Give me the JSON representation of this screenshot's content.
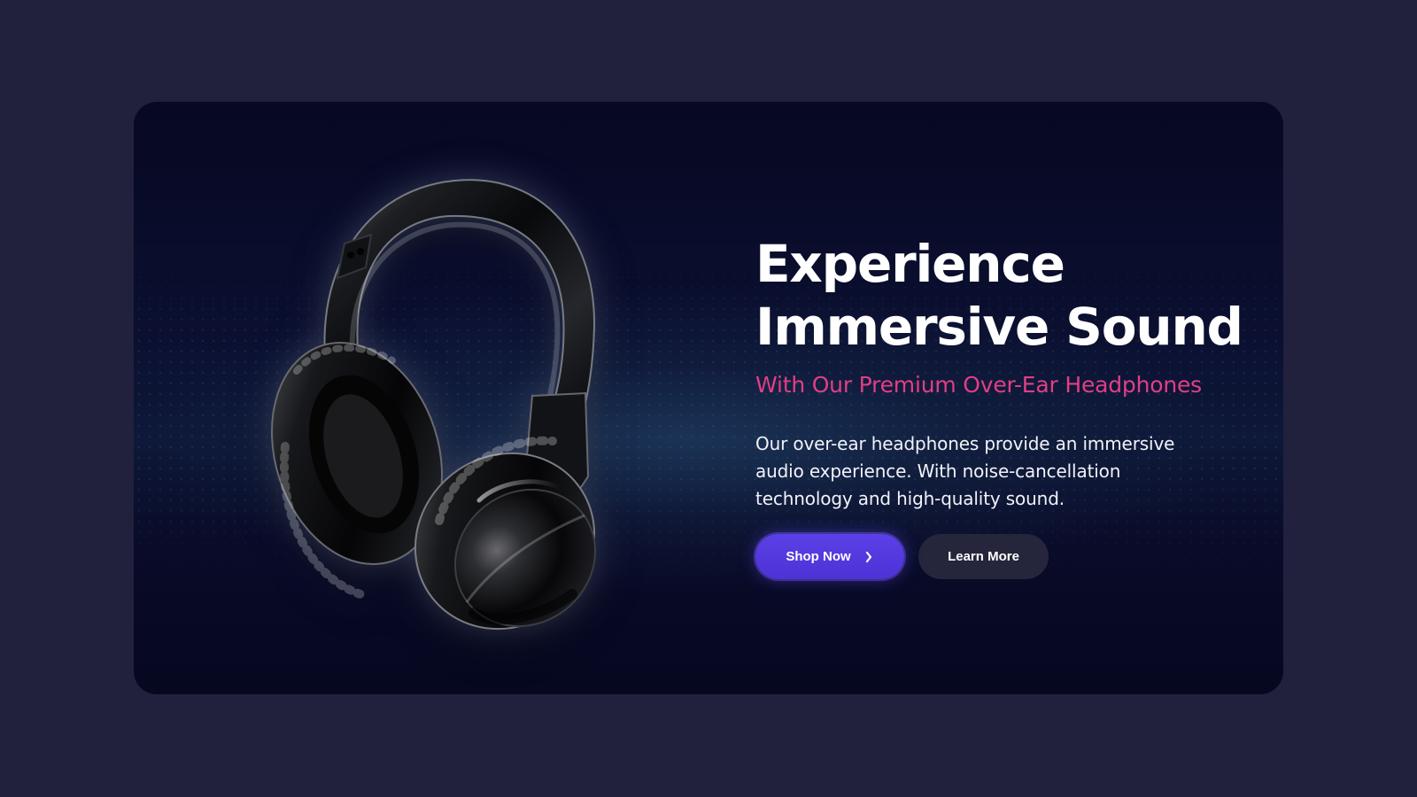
{
  "hero": {
    "title_line_1": "Experience",
    "title_line_2": "Immersive Sound",
    "subtitle": "With Our Premium Over-Ear Headphones",
    "description": "Our over-ear headphones provide an immersive audio experience. With noise-cancellation technology and high-quality sound.",
    "primary_button_label": "Shop Now",
    "secondary_button_label": "Learn More",
    "product_image": "headphones-image",
    "primary_icon": "chevron-right-icon"
  },
  "colors": {
    "page_background": "#21203d",
    "card_background": "#070821",
    "accent_pink": "#df3f85",
    "primary_button": "#5a40e6",
    "secondary_button": "#25263b",
    "text_primary": "#ffffff"
  }
}
